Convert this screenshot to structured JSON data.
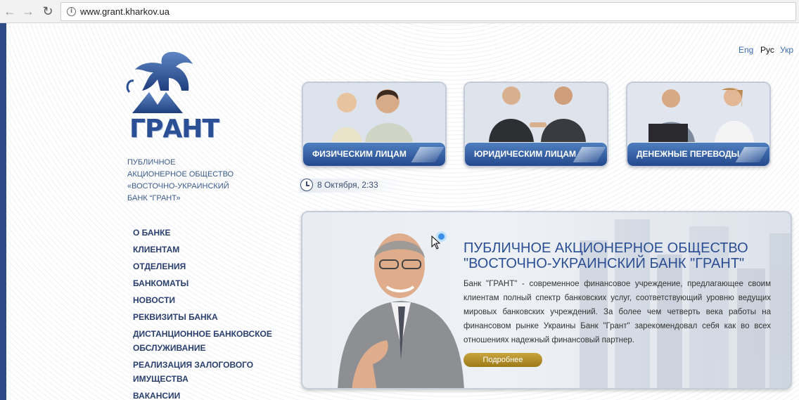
{
  "browser": {
    "url": "www.grant.kharkov.ua",
    "back_icon": "back-arrow-icon",
    "forward_icon": "forward-arrow-icon",
    "reload_icon": "reload-icon"
  },
  "languages": {
    "eng": "Eng",
    "rus": "Рус",
    "ukr": "Укр"
  },
  "logo": {
    "text": "ГРАНТ"
  },
  "bank_name": {
    "line1": "ПУБЛИЧНОЕ",
    "line2": "АКЦИОНЕРНОЕ ОБЩЕСТВО",
    "line3": "«ВОСТОЧНО-УКРАИНСКИЙ",
    "line4": "БАНК “ГРАНТ»"
  },
  "menu": {
    "items": [
      "О БАНКЕ",
      "КЛИЕНТАМ",
      "ОТДЕЛЕНИЯ",
      "БАНКОМАТЫ",
      "НОВОСТИ",
      "РЕКВИЗИТЫ БАНКА",
      "ДИСТАНЦИОННОЕ БАНКОВСКОЕ",
      "ОБСЛУЖИВАНИЕ",
      "РЕАЛИЗАЦИЯ ЗАЛОГОВОГО",
      "ИМУЩЕСТВА",
      "ВАКАНСИИ"
    ]
  },
  "tiles": {
    "individuals": "ФИЗИЧЕСКИМ ЛИЦАМ",
    "legal": "ЮРИДИЧЕСКИМ ЛИЦАМ",
    "transfers": "ДЕНЕЖНЫЕ ПЕРЕВОДЫ"
  },
  "date": "8 Октября, 2:33",
  "promo": {
    "title_line1": "ПУБЛИЧНОЕ АКЦИОНЕРНОЕ ОБЩЕСТВО",
    "title_line2": "\"ВОСТОЧНО-УКРАИНСКИЙ БАНК \"ГРАНТ\"",
    "text": "Банк \"ГРАНТ\" - современное финансовое учреждение, предлагающее своим клиентам  полный  спектр банковских услуг, соответствующий уровню ведущих мировых банковских учреждений. За более чем четверть века работы на финансовом рынке Украины Банк \"Грант\" зарекомендовал себя как во всех отношениях надежный финансовый партнер.",
    "more_button": "Подробнее"
  },
  "colors": {
    "brand_blue": "#2a4f94",
    "menu_text": "#2a3f6e",
    "button_gold": "#b58f2a"
  }
}
